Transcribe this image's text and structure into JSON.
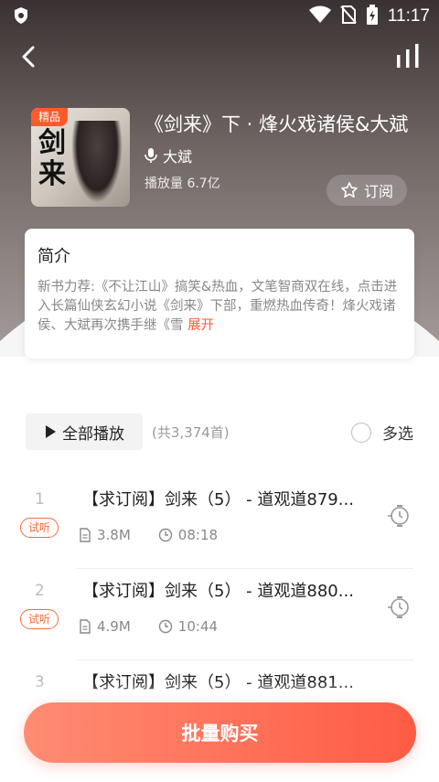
{
  "status_bar": {
    "time": "11:17"
  },
  "album": {
    "badge": "精品",
    "title": "《剑来》下 · 烽火戏诸侯&大斌",
    "author": "大斌",
    "plays": "播放量 6.7亿",
    "subscribe_label": "订阅",
    "cover_text": "剑来"
  },
  "intro": {
    "heading": "简介",
    "text": "新书力荐:《不让江山》搞笑&热血，文笔智商双在线，点击进入长篇仙侠玄幻小说《剑来》下部，重燃热血传奇！烽火戏诸侯、大斌再次携手继《雪",
    "expand_label": "展开"
  },
  "toolbar": {
    "play_all_label": "全部播放",
    "track_count": "(共3,374首)",
    "multi_select_label": "多选"
  },
  "tracks": [
    {
      "index": "1",
      "title": "【求订阅】剑来（5） - 道观道879...",
      "trial": "试听",
      "size": "3.8M",
      "duration": "08:18"
    },
    {
      "index": "2",
      "title": "【求订阅】剑来（5） - 道观道880...",
      "trial": "试听",
      "size": "4.9M",
      "duration": "10:44"
    },
    {
      "index": "3",
      "title": "【求订阅】剑来（5） - 道观道881..."
    }
  ],
  "buy_button_label": "批量购买",
  "colors": {
    "accent": "#ff5a2c",
    "buy_gradient_start": "#ff8c73",
    "buy_gradient_end": "#ff5b45"
  },
  "icons": [
    "shield-icon",
    "wifi-icon",
    "no-sim-icon",
    "battery-icon",
    "back-icon",
    "stats-icon",
    "mic-icon",
    "star-icon",
    "play-icon",
    "file-icon",
    "clock-icon",
    "history-icon"
  ]
}
